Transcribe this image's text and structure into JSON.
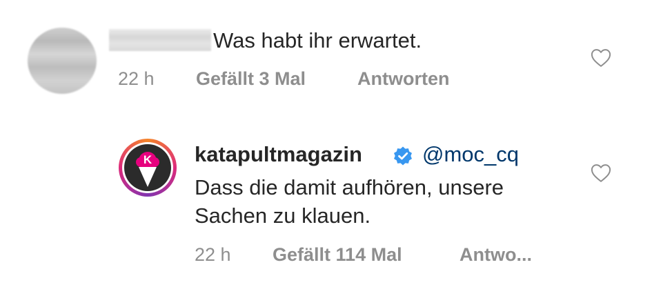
{
  "comments": [
    {
      "author": "",
      "text": "Was habt ihr erwartet.",
      "time": "22 h",
      "likes": "Gefällt 3 Mal",
      "reply": "Antworten",
      "like_icon": "heart-outline-icon"
    },
    {
      "author": "katapultmagazin",
      "verified_icon": "verified-badge-icon",
      "mention": "@moc_cq",
      "text_line1": "Dass die damit aufhören, unsere",
      "text_line2": "Sachen zu klauen.",
      "time": "22 h",
      "likes": "Gefällt 114 Mal",
      "reply": "Antwo...",
      "like_icon": "heart-outline-icon",
      "avatar_letter": "K"
    }
  ],
  "colors": {
    "text": "#262626",
    "meta": "#8e8e8e",
    "mention": "#00376b",
    "verified": "#3897f0",
    "brand_pink": "#e6007e"
  }
}
